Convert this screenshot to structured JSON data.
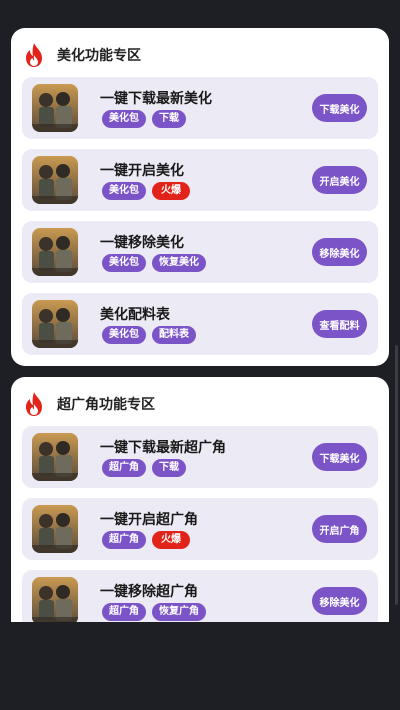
{
  "colors": {
    "accent": "#7b55c8",
    "hot": "#e2231a",
    "item_bg": "#eceaf4",
    "page_bg": "#1d1f24"
  },
  "sections": [
    {
      "title": "美化功能专区",
      "icon": "fire-icon",
      "items": [
        {
          "title": "一键下载最新美化",
          "tags": [
            "美化包",
            "下载"
          ],
          "button": "下载美化"
        },
        {
          "title": "一键开启美化",
          "tags": [
            "美化包",
            "火爆"
          ],
          "button": "开启美化"
        },
        {
          "title": "一键移除美化",
          "tags": [
            "美化包",
            "恢复美化"
          ],
          "button": "移除美化"
        },
        {
          "title": "美化配料表",
          "tags": [
            "美化包",
            "配料表"
          ],
          "button": "查看配料"
        }
      ]
    },
    {
      "title": "超广角功能专区",
      "icon": "fire-icon",
      "items": [
        {
          "title": "一键下载最新超广角",
          "tags": [
            "超广角",
            "下载"
          ],
          "button": "下载美化"
        },
        {
          "title": "一键开启超广角",
          "tags": [
            "超广角",
            "火爆"
          ],
          "button": "开启广角"
        },
        {
          "title": "一键移除超广角",
          "tags": [
            "超广角",
            "恢复广角"
          ],
          "button": "移除美化"
        }
      ]
    }
  ]
}
